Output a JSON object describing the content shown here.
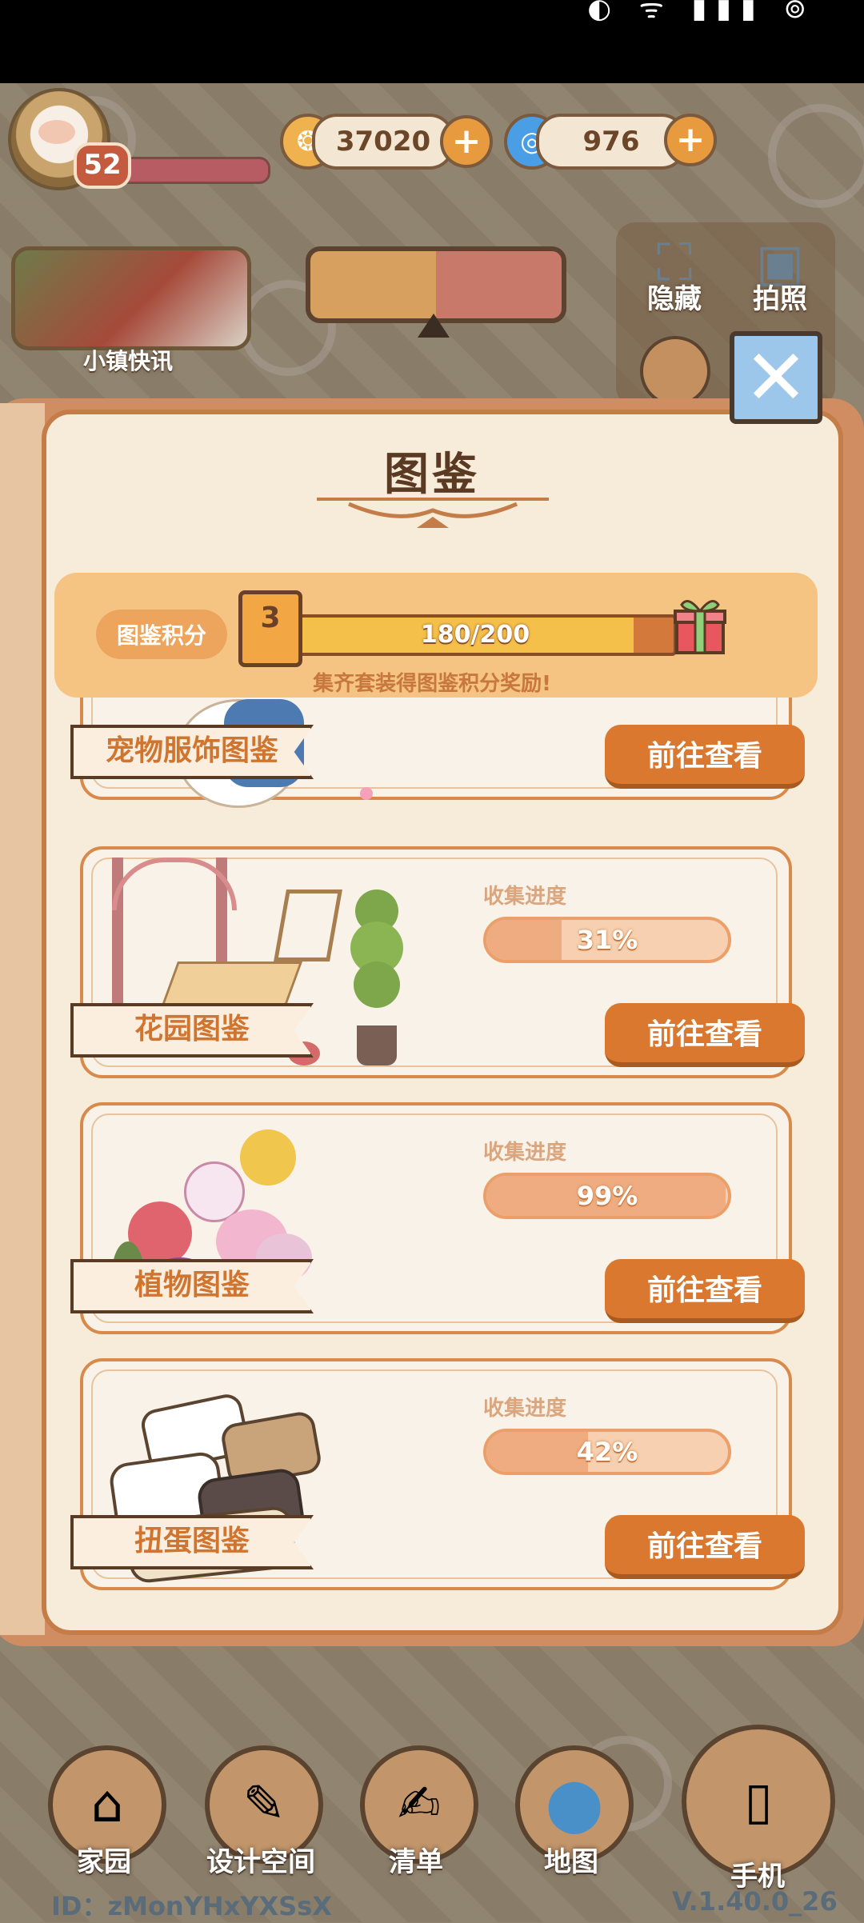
{
  "status_bar": {
    "icons": "◐ ᯤ ▮▮▮ ⊚"
  },
  "header": {
    "level": "52",
    "coins": "37020",
    "gems": "976",
    "plus": "+"
  },
  "news": {
    "label": "小镇快讯"
  },
  "tools": {
    "hide_label": "隐藏",
    "photo_label": "拍照",
    "close": "✕"
  },
  "book": {
    "title": "图鉴",
    "points_label": "图鉴积分",
    "points_level": "3",
    "points_text": "180/200",
    "points_progress": 0.9,
    "points_hint": "集齐套装得图鉴积分奖励!",
    "cards": [
      {
        "title": "宠物服饰图鉴",
        "button": "前往查看"
      },
      {
        "title": "花园图鉴",
        "progress_label": "收集进度",
        "progress_text": "31%",
        "progress": 0.31,
        "button": "前往查看"
      },
      {
        "title": "植物图鉴",
        "progress_label": "收集进度",
        "progress_text": "99%",
        "progress": 0.99,
        "button": "前往查看"
      },
      {
        "title": "扭蛋图鉴",
        "progress_label": "收集进度",
        "progress_text": "42%",
        "progress": 0.42,
        "button": "前往查看"
      }
    ]
  },
  "nav": {
    "home": "家园",
    "design": "设计空间",
    "list": "清单",
    "map": "地图",
    "phone": "手机"
  },
  "footer": {
    "id": "ID：zMonYHxYXSsX",
    "version": "V.1.40.0_26"
  }
}
